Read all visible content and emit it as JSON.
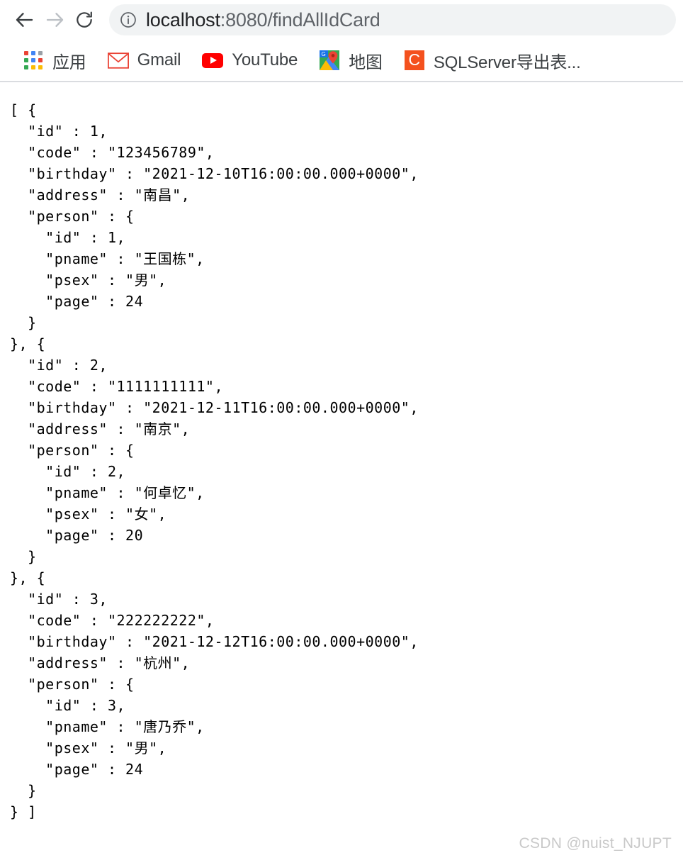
{
  "browser": {
    "back_label": "Back",
    "forward_label": "Forward",
    "reload_label": "Reload",
    "site_info_label": "View site information",
    "url_host": "localhost",
    "url_rest": ":8080/findAllIdCard",
    "url_full": "localhost:8080/findAllIdCard"
  },
  "bookmarks": [
    {
      "label": "应用",
      "icon": "apps-grid-icon"
    },
    {
      "label": "Gmail",
      "icon": "gmail-icon"
    },
    {
      "label": "YouTube",
      "icon": "youtube-icon"
    },
    {
      "label": "地图",
      "icon": "google-maps-icon"
    },
    {
      "label": "SQLServer导出表...",
      "icon": "csdn-c-icon"
    }
  ],
  "colors": {
    "apps_dot_red": "#ea4335",
    "apps_dot_blue": "#4285f4",
    "apps_dot_green": "#34a853",
    "apps_dot_yellow": "#fbbc05",
    "apps_dot_grey": "#9aa0a6",
    "youtube_red": "#ff0000",
    "gmail_red": "#ea4335",
    "csdn_orange": "#f4511e",
    "omnibox_bg": "#f1f3f4",
    "url_host_color": "#202124",
    "url_rest_color": "#5f6368",
    "watermark_color": "#c9c9c9",
    "separator": "#dadce0"
  },
  "page": {
    "json_text": "[ {\n  \"id\" : 1,\n  \"code\" : \"123456789\",\n  \"birthday\" : \"2021-12-10T16:00:00.000+0000\",\n  \"address\" : \"南昌\",\n  \"person\" : {\n    \"id\" : 1,\n    \"pname\" : \"王国栋\",\n    \"psex\" : \"男\",\n    \"page\" : 24\n  }\n}, {\n  \"id\" : 2,\n  \"code\" : \"1111111111\",\n  \"birthday\" : \"2021-12-11T16:00:00.000+0000\",\n  \"address\" : \"南京\",\n  \"person\" : {\n    \"id\" : 2,\n    \"pname\" : \"何卓忆\",\n    \"psex\" : \"女\",\n    \"page\" : 20\n  }\n}, {\n  \"id\" : 3,\n  \"code\" : \"222222222\",\n  \"birthday\" : \"2021-12-12T16:00:00.000+0000\",\n  \"address\" : \"杭州\",\n  \"person\" : {\n    \"id\" : 3,\n    \"pname\" : \"唐乃乔\",\n    \"psex\" : \"男\",\n    \"page\" : 24\n  }\n} ]",
    "records": [
      {
        "id": 1,
        "code": "123456789",
        "birthday": "2021-12-10T16:00:00.000+0000",
        "address": "南昌",
        "person": {
          "id": 1,
          "pname": "王国栋",
          "psex": "男",
          "page": 24
        }
      },
      {
        "id": 2,
        "code": "1111111111",
        "birthday": "2021-12-11T16:00:00.000+0000",
        "address": "南京",
        "person": {
          "id": 2,
          "pname": "何卓忆",
          "psex": "女",
          "page": 20
        }
      },
      {
        "id": 3,
        "code": "222222222",
        "birthday": "2021-12-12T16:00:00.000+0000",
        "address": "杭州",
        "person": {
          "id": 3,
          "pname": "唐乃乔",
          "psex": "男",
          "page": 24
        }
      }
    ]
  },
  "watermark": "CSDN @nuist_NJUPT"
}
